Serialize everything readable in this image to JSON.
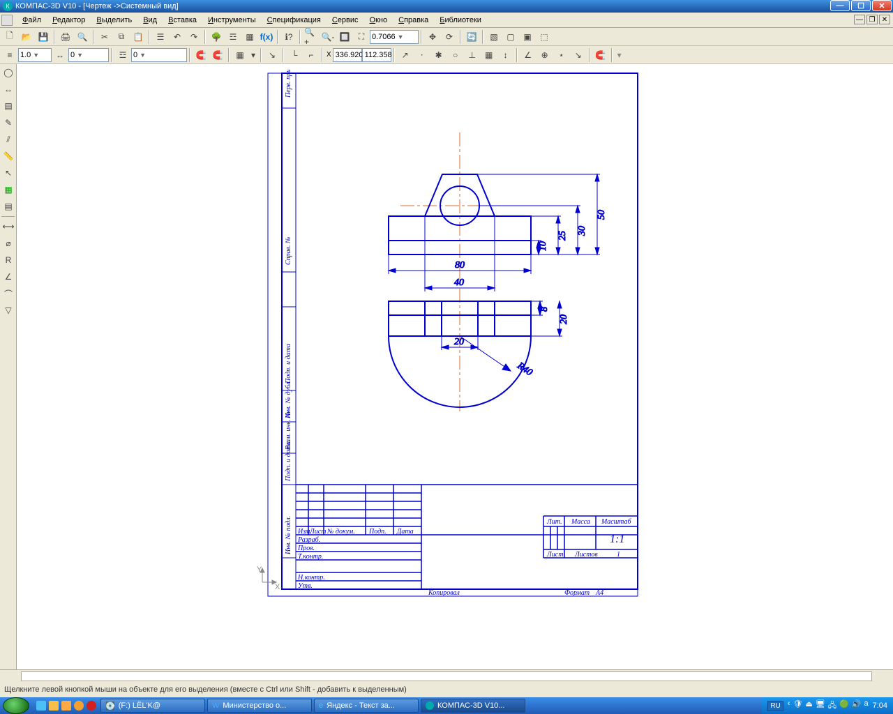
{
  "titlebar": {
    "title": "КОМПАС-3D V10 - [Чертеж ->Системный вид]"
  },
  "menu": {
    "file": "Файл",
    "edit": "Редактор",
    "select": "Выделить",
    "view": "Вид",
    "insert": "Вставка",
    "tools": "Инструменты",
    "spec": "Спецификация",
    "service": "Сервис",
    "window": "Окно",
    "help": "Справка",
    "libs": "Библиотеки"
  },
  "toolbar1": {
    "zoom": "0.7066"
  },
  "toolbar2": {
    "style_num": "1.0",
    "step": "0",
    "layer": "0",
    "coord_x": "336.920",
    "coord_y": "112.358"
  },
  "drawing": {
    "dims": {
      "d80": "80",
      "d40": "40",
      "d20": "20",
      "d10": "10",
      "d25": "25",
      "d30": "30",
      "d50": "50",
      "d8": "8",
      "d20b": "20",
      "r40": "R40"
    },
    "frame": {
      "izm": "Изм.",
      "list": "Лист",
      "ndoc": "№ докум.",
      "podp": "Подп.",
      "data": "Дата",
      "razrab": "Разраб.",
      "prov": "Пров.",
      "tkontr": "Т.контр.",
      "nkontr": "Н.контр.",
      "utv": "Утв.",
      "lit": "Лит.",
      "massa": "Масса",
      "mashtab": "Масштаб",
      "scale": "1:1",
      "list2": "Лист",
      "listov": "Листов",
      "listov_n": "1",
      "kopiroval": "Копировал",
      "format": "Формат",
      "a4": "А4",
      "perv": "Перв. примен.",
      "sprav": "Справ. №",
      "podp_data": "Подп. и дата",
      "inv_dubl": "Инв. № дубл.",
      "vzam": "Взам. инв. №",
      "podp_data2": "Подп. и дата",
      "inv_podl": "Инв. № подл."
    }
  },
  "statusbar": {
    "hint": "Щелкните левой кнопкой мыши на объекте для его выделения (вместе с Ctrl или Shift - добавить к выделенным)"
  },
  "taskbar": {
    "t1": "(F:) LЁL'K@",
    "t2": "Министерство о...",
    "t3": "Яндекс - Текст за...",
    "t4": "КОМПАС-3D V10...",
    "lang": "RU",
    "time": "7:04"
  },
  "coords_origin": {
    "x_label": "X",
    "y_label": "Y"
  }
}
